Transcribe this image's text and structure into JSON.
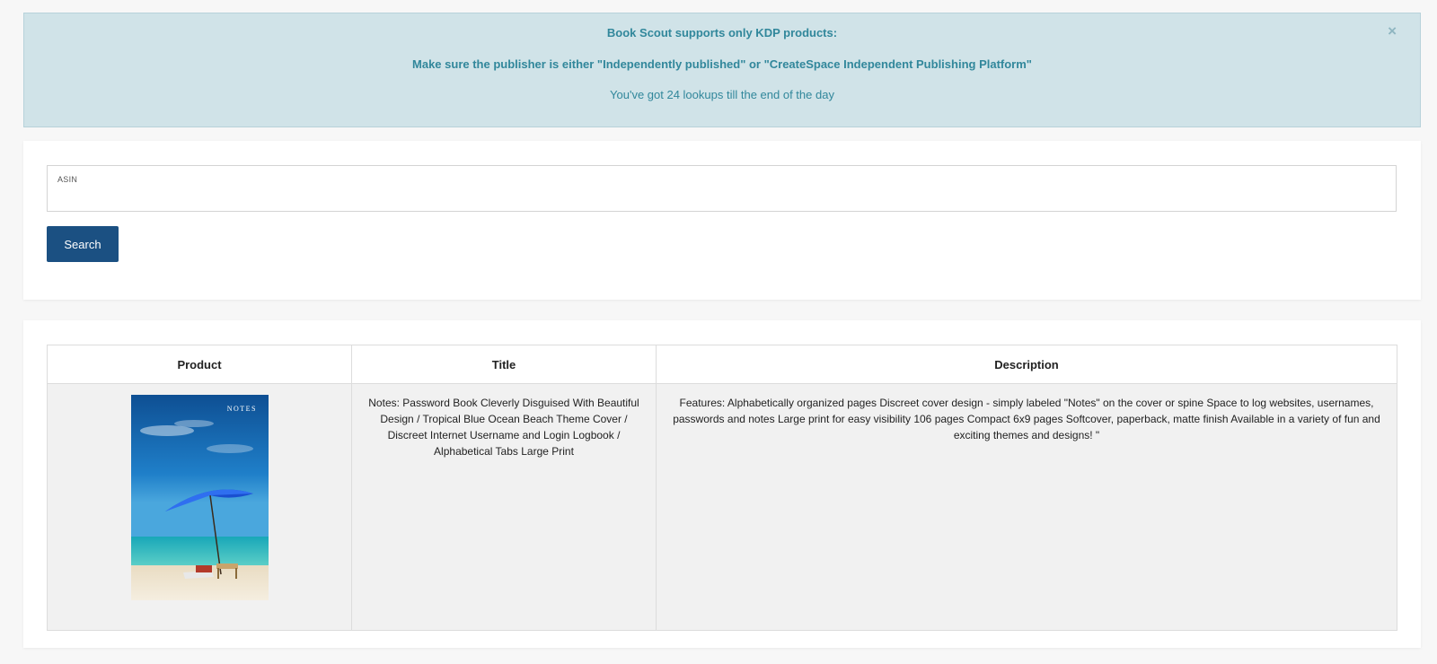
{
  "alert": {
    "line1": "Book Scout supports only KDP products:",
    "line2": "Make sure the publisher is either \"Independently published\" or \"CreateSpace Independent Publishing Platform\"",
    "line3": "You've got 24 lookups till the end of the day",
    "close": "×"
  },
  "search": {
    "field_label": "ASIN",
    "field_value": "",
    "button_label": "Search"
  },
  "results": {
    "columns": [
      "Product",
      "Title",
      "Description"
    ],
    "rows": [
      {
        "cover_text": "NOTES",
        "title": "Notes: Password Book Cleverly Disguised With Beautiful Design / Tropical Blue Ocean Beach Theme Cover / Discreet Internet Username and Login Logbook / Alphabetical Tabs Large Print",
        "description": "Features: Alphabetically organized pages Discreet cover design - simply labeled \"Notes\" on the cover or spine Space to log websites, usernames, passwords and notes Large print for easy visibility 106 pages Compact 6x9 pages Softcover, paperback, matte finish Available in a variety of fun and exciting themes and designs! \""
      }
    ]
  },
  "colors": {
    "alert_bg": "#d0e3e8",
    "alert_text": "#31879b",
    "button_bg": "#1b5082"
  }
}
